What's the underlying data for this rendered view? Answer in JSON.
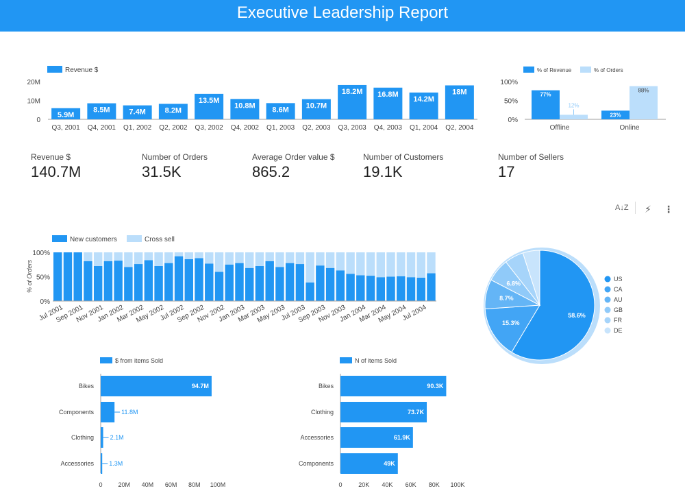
{
  "header": {
    "title": "Executive Leadership Report"
  },
  "kpis": [
    {
      "label": "Revenue $",
      "value": "140.7M"
    },
    {
      "label": "Number of Orders",
      "value": "31.5K"
    },
    {
      "label": "Average Order value $",
      "value": "865.2"
    },
    {
      "label": "Number of Customers",
      "value": "19.1K"
    },
    {
      "label": "Number of Sellers",
      "value": "17"
    }
  ],
  "toolbar": {
    "sort_icon_text": "A↓Z",
    "bolt_icon_text": "⚡",
    "more_icon_text": "⋮"
  },
  "colors": {
    "primary": "#2196f3",
    "light": "#bbdefb",
    "header": "#2196f3"
  },
  "chart_data": [
    {
      "id": "revenue",
      "type": "bar",
      "legend": [
        "Revenue $"
      ],
      "categories": [
        "Q3, 2001",
        "Q4, 2001",
        "Q1, 2002",
        "Q2, 2002",
        "Q3, 2002",
        "Q4, 2002",
        "Q1, 2003",
        "Q2, 2003",
        "Q3, 2003",
        "Q4, 2003",
        "Q1, 2004",
        "Q2, 2004"
      ],
      "values": [
        5.9,
        8.5,
        7.4,
        8.2,
        13.5,
        10.8,
        8.6,
        10.7,
        18.2,
        16.8,
        14.2,
        18.0
      ],
      "data_labels": [
        "5.9M",
        "8.5M",
        "7.4M",
        "8.2M",
        "13.5M",
        "10.8M",
        "8.6M",
        "10.7M",
        "18.2M",
        "16.8M",
        "14.2M",
        "18M"
      ],
      "yticks": [
        "0",
        "10M",
        "20M"
      ],
      "ylim": [
        0,
        20
      ]
    },
    {
      "id": "channel",
      "type": "bar",
      "legend": [
        "% of Revenue",
        "% of Orders"
      ],
      "categories": [
        "Offline",
        "Online"
      ],
      "series": [
        {
          "name": "% of Revenue",
          "values": [
            77,
            23
          ],
          "labels": [
            "77%",
            "23%"
          ]
        },
        {
          "name": "% of Orders",
          "values": [
            12,
            88
          ],
          "labels": [
            "12%",
            "88%"
          ]
        }
      ],
      "yticks": [
        "0%",
        "50%",
        "100%"
      ],
      "ylim": [
        0,
        100
      ]
    },
    {
      "id": "customers",
      "type": "bar",
      "stacked": true,
      "legend": [
        "New customers",
        "Cross sell"
      ],
      "ylabel": "% of Orders",
      "yticks": [
        "0%",
        "50%",
        "100%"
      ],
      "ylim": [
        0,
        100
      ],
      "x_tick_labels": [
        "Jul 2001",
        "Sep 2001",
        "Nov 2001",
        "Jan 2002",
        "Mar 2002",
        "May 2002",
        "Jul 2002",
        "Sep 2002",
        "Nov 2002",
        "Jan 2003",
        "Mar 2003",
        "May 2003",
        "Jul 2003",
        "Sep 2003",
        "Nov 2003",
        "Jan 2004",
        "Mar 2004",
        "May 2004",
        "Jul 2004"
      ],
      "categories": [
        "Jul 2001",
        "Aug 2001",
        "Sep 2001",
        "Oct 2001",
        "Nov 2001",
        "Dec 2001",
        "Jan 2002",
        "Feb 2002",
        "Mar 2002",
        "Apr 2002",
        "May 2002",
        "Jun 2002",
        "Jul 2002",
        "Aug 2002",
        "Sep 2002",
        "Oct 2002",
        "Nov 2002",
        "Dec 2002",
        "Jan 2003",
        "Feb 2003",
        "Mar 2003",
        "Apr 2003",
        "May 2003",
        "Jun 2003",
        "Jul 2003",
        "Aug 2003",
        "Sep 2003",
        "Oct 2003",
        "Nov 2003",
        "Dec 2003",
        "Jan 2004",
        "Feb 2004",
        "Mar 2004",
        "Apr 2004",
        "May 2004",
        "Jun 2004",
        "Jul 2004"
      ],
      "new_customers": [
        100,
        100,
        100,
        82,
        72,
        82,
        83,
        70,
        76,
        84,
        72,
        78,
        92,
        86,
        88,
        77,
        60,
        75,
        78,
        68,
        72,
        82,
        70,
        78,
        76,
        38,
        73,
        68,
        63,
        56,
        53,
        52,
        49,
        50,
        51,
        49,
        48,
        57
      ],
      "cross_sell": [
        0,
        0,
        0,
        18,
        28,
        18,
        17,
        30,
        24,
        16,
        28,
        22,
        8,
        14,
        12,
        23,
        40,
        25,
        22,
        32,
        28,
        18,
        30,
        22,
        24,
        62,
        27,
        32,
        37,
        44,
        47,
        48,
        51,
        50,
        49,
        51,
        52,
        43
      ]
    },
    {
      "id": "country",
      "type": "pie",
      "legend": [
        "US",
        "CA",
        "AU",
        "GB",
        "FR",
        "DE"
      ],
      "values": [
        58.6,
        15.3,
        8.7,
        6.8,
        5.6,
        5.0
      ],
      "labels": [
        "58.6%",
        "15.3%",
        "8.7%",
        "6.8%",
        "",
        ""
      ],
      "colors": [
        "#2196f3",
        "#42a5f5",
        "#64b5f6",
        "#90caf9",
        "#a6d4fa",
        "#c8e4fc"
      ]
    },
    {
      "id": "sold_dollars",
      "type": "bar",
      "orientation": "horizontal",
      "legend": [
        "$ from items Sold"
      ],
      "categories": [
        "Bikes",
        "Components",
        "Clothing",
        "Accessories"
      ],
      "values": [
        94.7,
        11.8,
        2.1,
        1.3
      ],
      "data_labels": [
        "94.7M",
        "11.8M",
        "2.1M",
        "1.3M"
      ],
      "xticks": [
        "0",
        "20M",
        "40M",
        "60M",
        "80M",
        "100M"
      ],
      "xlim": [
        0,
        100
      ]
    },
    {
      "id": "sold_count",
      "type": "bar",
      "orientation": "horizontal",
      "legend": [
        "N of items Sold"
      ],
      "categories": [
        "Bikes",
        "Clothing",
        "Accessories",
        "Components"
      ],
      "values": [
        90.3,
        73.7,
        61.9,
        49
      ],
      "data_labels": [
        "90.3K",
        "73.7K",
        "61.9K",
        "49K"
      ],
      "xticks": [
        "0",
        "20K",
        "40K",
        "60K",
        "80K",
        "100K"
      ],
      "xlim": [
        0,
        100
      ]
    }
  ]
}
